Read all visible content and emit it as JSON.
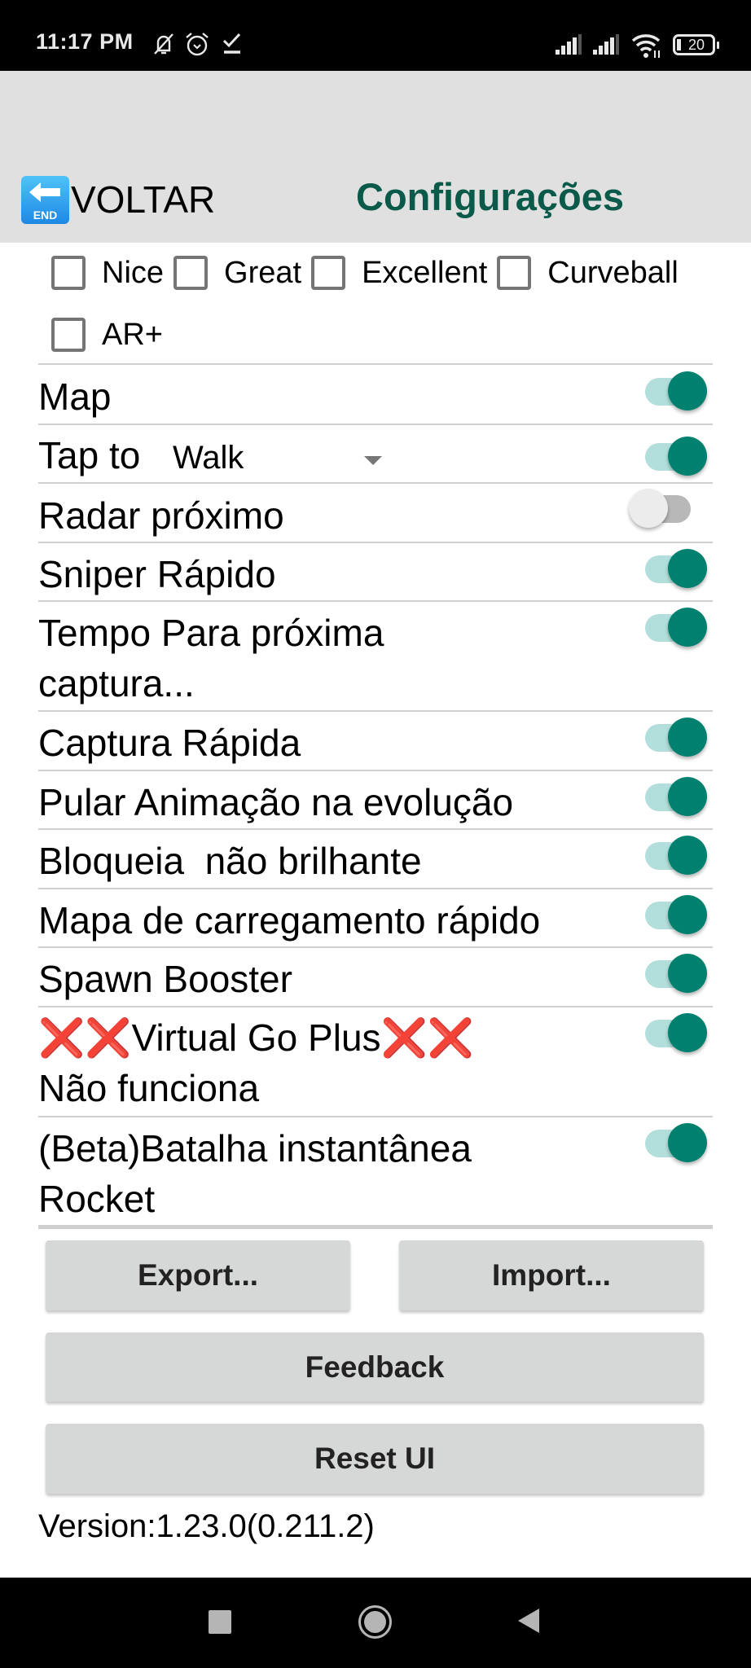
{
  "status_bar": {
    "time": "11:17 PM",
    "left_icons": [
      "mute-bell-icon",
      "alarm-icon",
      "download-done-icon"
    ],
    "right_icons": [
      "signal-icon",
      "signal-icon",
      "wifi-icon",
      "battery-icon"
    ],
    "battery_level": "20"
  },
  "header": {
    "back_icon": "end-arrow-icon",
    "back_icon_text": "END",
    "back_label": "VOLTAR",
    "title": "Configurações",
    "title_color": "#0a5a4a"
  },
  "throw_options": [
    {
      "label": "Nice",
      "checked": false
    },
    {
      "label": "Great",
      "checked": false
    },
    {
      "label": "Excellent",
      "checked": false
    },
    {
      "label": "Curveball",
      "checked": false
    },
    {
      "label": "AR+",
      "checked": false
    }
  ],
  "settings": [
    {
      "label": "Map",
      "enabled": true
    },
    {
      "label": "Tap to",
      "spinner_value": "Walk",
      "enabled": true
    },
    {
      "label": "Radar próximo",
      "enabled": false
    },
    {
      "label": "Sniper Rápido",
      "enabled": true
    },
    {
      "label": "Tempo Para próxima captura...",
      "enabled": true
    },
    {
      "label": "Captura Rápida",
      "enabled": true
    },
    {
      "label": "Pular Animação na evolução",
      "enabled": true
    },
    {
      "label": "Bloqueia  não brilhante",
      "enabled": true
    },
    {
      "label": "Mapa de carregamento rápido",
      "enabled": true
    },
    {
      "label": "Spawn Booster",
      "enabled": true
    },
    {
      "label_prefix": "❌❌",
      "label_main": "Virtual Go Plus",
      "label_suffix": "❌❌",
      "label_line2": "Não funciona",
      "enabled": true
    },
    {
      "label": "(Beta)Batalha instantânea Rocket",
      "enabled": true
    }
  ],
  "buttons": {
    "export": "Export...",
    "import": "Import...",
    "feedback": "Feedback",
    "reset": "Reset UI"
  },
  "version": "Version:1.23.0(0.211.2)",
  "colors": {
    "accent": "#00806e",
    "accent_track": "#b2dfdb",
    "header_bg": "#e0e0e0",
    "button_bg": "#d6d7d7"
  },
  "nav_bar": {
    "buttons": [
      "recent-apps-icon",
      "home-icon",
      "back-icon"
    ]
  }
}
